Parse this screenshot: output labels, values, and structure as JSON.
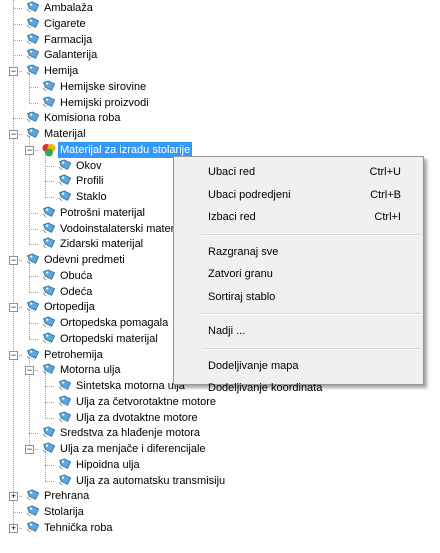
{
  "tree": [
    {
      "label": "Ambalaža",
      "level": 0,
      "leaf": true
    },
    {
      "label": "Cigarete",
      "level": 0,
      "leaf": true
    },
    {
      "label": "Farmacija",
      "level": 0,
      "leaf": true
    },
    {
      "label": "Galanterija",
      "level": 0,
      "leaf": true
    },
    {
      "label": "Hemija",
      "level": 0,
      "expanded": true
    },
    {
      "label": "Hemijske sirovine",
      "level": 1,
      "leaf": true
    },
    {
      "label": "Hemijski proizvodi",
      "level": 1,
      "leaf": true
    },
    {
      "label": "Komisiona roba",
      "level": 0,
      "leaf": true
    },
    {
      "label": "Materijal",
      "level": 0,
      "expanded": true
    },
    {
      "label": "Materijal za izradu stolarije",
      "level": 1,
      "expanded": true,
      "selected": true,
      "special": true
    },
    {
      "label": "Okov",
      "level": 2,
      "leaf": true
    },
    {
      "label": "Profili",
      "level": 2,
      "leaf": true
    },
    {
      "label": "Staklo",
      "level": 2,
      "leaf": true
    },
    {
      "label": "Potrošni materijal",
      "level": 1,
      "leaf": true
    },
    {
      "label": "Vodoinstalaterski materijal",
      "level": 1,
      "leaf": true
    },
    {
      "label": "Zidarski materijal",
      "level": 1,
      "leaf": true
    },
    {
      "label": "Odevni predmeti",
      "level": 0,
      "expanded": true
    },
    {
      "label": "Obuća",
      "level": 1,
      "leaf": true
    },
    {
      "label": "Odeća",
      "level": 1,
      "leaf": true
    },
    {
      "label": "Ortopedija",
      "level": 0,
      "expanded": true
    },
    {
      "label": "Ortopedska pomagala",
      "level": 1,
      "leaf": true
    },
    {
      "label": "Ortopedski materijal",
      "level": 1,
      "leaf": true
    },
    {
      "label": "Petrohemija",
      "level": 0,
      "expanded": true
    },
    {
      "label": "Motorna ulja",
      "level": 1,
      "expanded": true
    },
    {
      "label": "Sintetska motorna ulja",
      "level": 2,
      "leaf": true
    },
    {
      "label": "Ulja za četvorotaktne motore",
      "level": 2,
      "leaf": true
    },
    {
      "label": "Ulja za dvotaktne motore",
      "level": 2,
      "leaf": true
    },
    {
      "label": "Sredstva za hlađenje motora",
      "level": 1,
      "leaf": true
    },
    {
      "label": "Ulja za menjače i diferencijale",
      "level": 1,
      "expanded": true
    },
    {
      "label": "Hipoidna ulja",
      "level": 2,
      "leaf": true
    },
    {
      "label": "Ulja za automatsku transmisiju",
      "level": 2,
      "leaf": true
    },
    {
      "label": "Prehrana",
      "level": 0,
      "expanded": false
    },
    {
      "label": "Stolarija",
      "level": 0,
      "leaf": true
    },
    {
      "label": "Tehnička roba",
      "level": 0,
      "expanded": false
    }
  ],
  "context_menu": [
    {
      "label": "Ubaci red",
      "shortcut": "Ctrl+U"
    },
    {
      "label": "Ubaci podredjeni",
      "shortcut": "Ctrl+B"
    },
    {
      "label": "Izbaci red",
      "shortcut": "Ctrl+I"
    },
    {
      "separator": true
    },
    {
      "label": "Razgranaj sve",
      "shortcut": ""
    },
    {
      "label": "Zatvori granu",
      "shortcut": ""
    },
    {
      "label": "Sortiraj stablo",
      "shortcut": ""
    },
    {
      "separator": true
    },
    {
      "label": "Nadji ...",
      "shortcut": ""
    },
    {
      "separator": true
    },
    {
      "label": "Dodeljivanje mapa",
      "shortcut": ""
    },
    {
      "label": "Dodeljivanje koordinata",
      "shortcut": ""
    }
  ],
  "colors": {
    "selection": "#3399ff",
    "tag_icon": "#5aa7d8",
    "tree_lines": "#a0a0a0"
  }
}
